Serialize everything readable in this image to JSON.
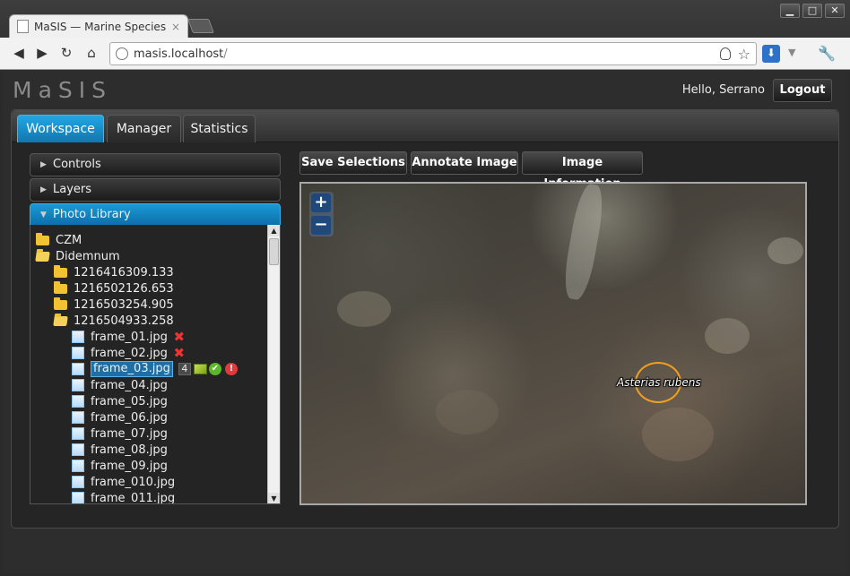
{
  "browser": {
    "tab_title": "MaSIS — Marine Species",
    "tab_close": "×",
    "url_host": "masis.localhost",
    "url_path": "/"
  },
  "app": {
    "logo": "MaSIS",
    "greeting": "Hello, Serrano",
    "logout_label": "Logout"
  },
  "tabs": [
    {
      "label": "Workspace",
      "active": true
    },
    {
      "label": "Manager",
      "active": false
    },
    {
      "label": "Statistics",
      "active": false
    }
  ],
  "accordion": {
    "controls": "Controls",
    "layers": "Layers",
    "photo_library": "Photo Library"
  },
  "tree": [
    {
      "label": "CZM",
      "type": "folder"
    },
    {
      "label": "Didemnum",
      "type": "folder-open"
    },
    {
      "label": "1216416309.133",
      "type": "folder"
    },
    {
      "label": "1216502126.653",
      "type": "folder"
    },
    {
      "label": "1216503254.905",
      "type": "folder"
    },
    {
      "label": "1216504933.258",
      "type": "folder-open"
    },
    {
      "label": "frame_01.jpg",
      "type": "file",
      "status": "rejected"
    },
    {
      "label": "frame_02.jpg",
      "type": "file",
      "status": "rejected"
    },
    {
      "label": "frame_03.jpg",
      "type": "file",
      "selected": true,
      "annotation_count": "4"
    },
    {
      "label": "frame_04.jpg",
      "type": "file"
    },
    {
      "label": "frame_05.jpg",
      "type": "file"
    },
    {
      "label": "frame_06.jpg",
      "type": "file"
    },
    {
      "label": "frame_07.jpg",
      "type": "file"
    },
    {
      "label": "frame_08.jpg",
      "type": "file"
    },
    {
      "label": "frame_09.jpg",
      "type": "file"
    },
    {
      "label": "frame_010.jpg",
      "type": "file"
    },
    {
      "label": "frame_011.jpg",
      "type": "file"
    }
  ],
  "actions": {
    "save_selections": "Save Selections",
    "annotate_image": "Annotate Image",
    "image_information": "Image Information"
  },
  "viewer": {
    "zoom_in": "+",
    "zoom_out": "−",
    "annotation_label": "Asterias rubens"
  },
  "colors": {
    "accent": "#1a9ad6",
    "annotation_outline": "#f0a020",
    "reject_icon": "#e33333"
  }
}
